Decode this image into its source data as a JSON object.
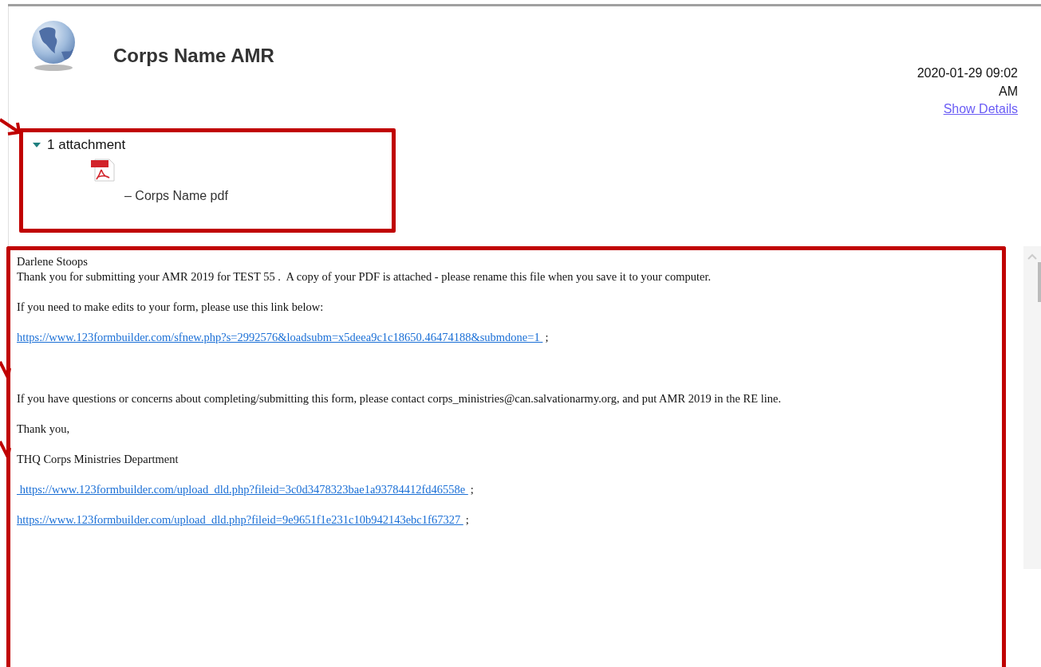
{
  "header": {
    "sender": "Corps Name AMR",
    "date": "2020-01-29 09:02 AM",
    "details_link": "Show Details"
  },
  "attachments": {
    "expanded": true,
    "summary": "1 attachment",
    "files": [
      {
        "name": "– Corps Name pdf"
      }
    ]
  },
  "message": {
    "paragraphs": [
      {
        "kind": "text",
        "text": "Darlene Stoops"
      },
      {
        "kind": "text",
        "text": "Thank you for submitting your AMR 2019 for TEST 55 .  A copy of your PDF is attached - please rename this file when you save it to your computer."
      },
      {
        "kind": "text",
        "text": "If you need to make edits to your form, please use this link below:"
      },
      {
        "kind": "link",
        "url": "https://www.123formbuilder.com/sfnew.php?s=2992576&loadsubm=x5deea9c1c18650.46474188&submdone=1 ",
        "suffix": ";"
      },
      {
        "kind": "text",
        "text": "If you have questions or concerns about completing/submitting this form, please contact corps_ministries@can.salvationarmy.org, and put AMR 2019 in the RE line."
      },
      {
        "kind": "text",
        "text": "Thank you,"
      },
      {
        "kind": "text",
        "text": "THQ Corps Ministries Department"
      },
      {
        "kind": "link",
        "url": " https://www.123formbuilder.com/upload_dld.php?fileid=3c0d3478323bae1a93784412fd46558e ",
        "suffix": ";"
      },
      {
        "kind": "link",
        "url": "https://www.123formbuilder.com/upload_dld.php?fileid=9e9651f1e231c10b942143ebc1f67327 ",
        "suffix": ";"
      }
    ]
  }
}
